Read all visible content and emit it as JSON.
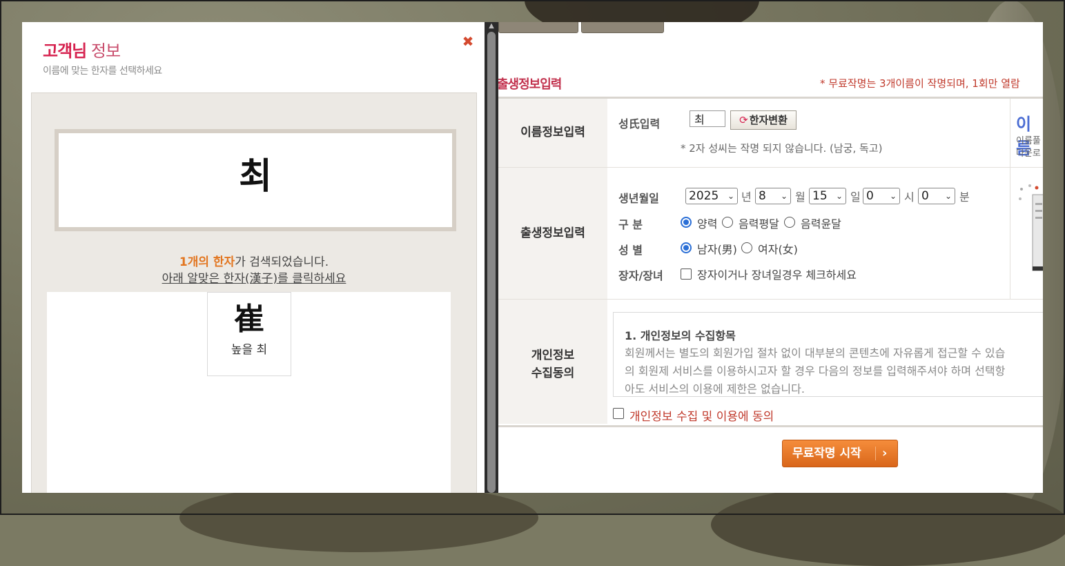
{
  "modal": {
    "title_strong": "고객님",
    "title_rest": " 정보",
    "description": "이름에 맞는 한자를 선택하세요",
    "close_icon": "close-icon",
    "surname": "최",
    "result_count": "1개의 한자",
    "result_rest": "가 검색되었습니다.",
    "result_hint": "아래 알맞은 한자(漢子)를 클릭하세요",
    "hanja_options": [
      {
        "char": "崔",
        "reading": "높을 최"
      }
    ]
  },
  "page": {
    "section_title": "출생정보입력",
    "notice": "* 무료작명는 3개이름이 작명되며, 1회만 열람",
    "name_row": {
      "label": "이름정보입력",
      "field_label": "성氏입력",
      "surname_value": "최",
      "hanja_button": "한자변환",
      "note": "* 2자 성씨는 작명 되지 않습니다. (남궁, 독고)"
    },
    "birth_row": {
      "label": "출생정보입력",
      "birth_label": "생년월일",
      "year": "2025",
      "year_unit": "년",
      "month": "8",
      "month_unit": "월",
      "day": "15",
      "day_unit": "일",
      "hour": "0",
      "hour_unit": "시",
      "minute": "0",
      "minute_unit": "분",
      "calendar_label": "구 분",
      "calendar_options": [
        "양력",
        "음력평달",
        "음력윤달"
      ],
      "calendar_selected": "양력",
      "gender_label": "성 별",
      "gender_options": [
        "남자(男)",
        "여자(女)"
      ],
      "gender_selected": "남자(男)",
      "eldest_label": "장자/장녀",
      "eldest_check": "장자이거나 장녀일경우 체크하세요"
    },
    "privacy_row": {
      "label_line1": "개인정보",
      "label_line2": "수집동의",
      "heading": "1. 개인정보의 수집항목",
      "body": "회원께서는 별도의 회원가입 절차 없이 대부분의 콘텐츠에 자유롭게 접근할 수 있습\n의 회원제 서비스를 이용하시고자 할 경우 다음의 정보를 입력해주셔야 하며 선택항\n아도 서비스의 이용에 제한은 없습니다.",
      "agree": "개인정보 수집 및 이용에 동의"
    },
    "start_button": "무료작명 시작",
    "side_title": "이름",
    "side_text_line1": "이름풀",
    "side_text_line2": "다운로"
  },
  "colors": {
    "accent_pink": "#d6224f",
    "accent_orange": "#e2751f",
    "notice_red": "#c0392b",
    "radio_blue": "#2b6fd6"
  }
}
